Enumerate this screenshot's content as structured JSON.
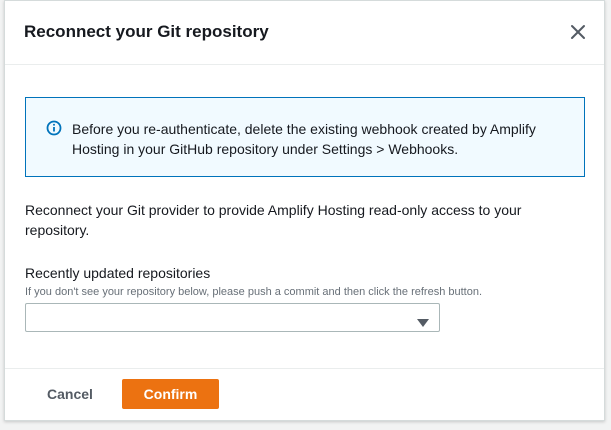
{
  "modal": {
    "title": "Reconnect your Git repository",
    "close_icon": "close-icon"
  },
  "info_alert": {
    "icon": "info-icon",
    "text": "Before you re-authenticate, delete the existing webhook created by Amplify Hosting in your GitHub repository under Settings > Webhooks."
  },
  "body": {
    "description": "Reconnect your Git provider to provide Amplify Hosting read-only access to your repository."
  },
  "repo_field": {
    "label": "Recently updated repositories",
    "description": "If you don't see your repository below, please push a commit and then click the refresh button.",
    "selected_value": "",
    "caret_icon": "caret-down-icon"
  },
  "footer": {
    "cancel_label": "Cancel",
    "confirm_label": "Confirm"
  },
  "colors": {
    "accent": "#ec7211",
    "info_border": "#0073bb",
    "info_background": "#f1faff"
  }
}
